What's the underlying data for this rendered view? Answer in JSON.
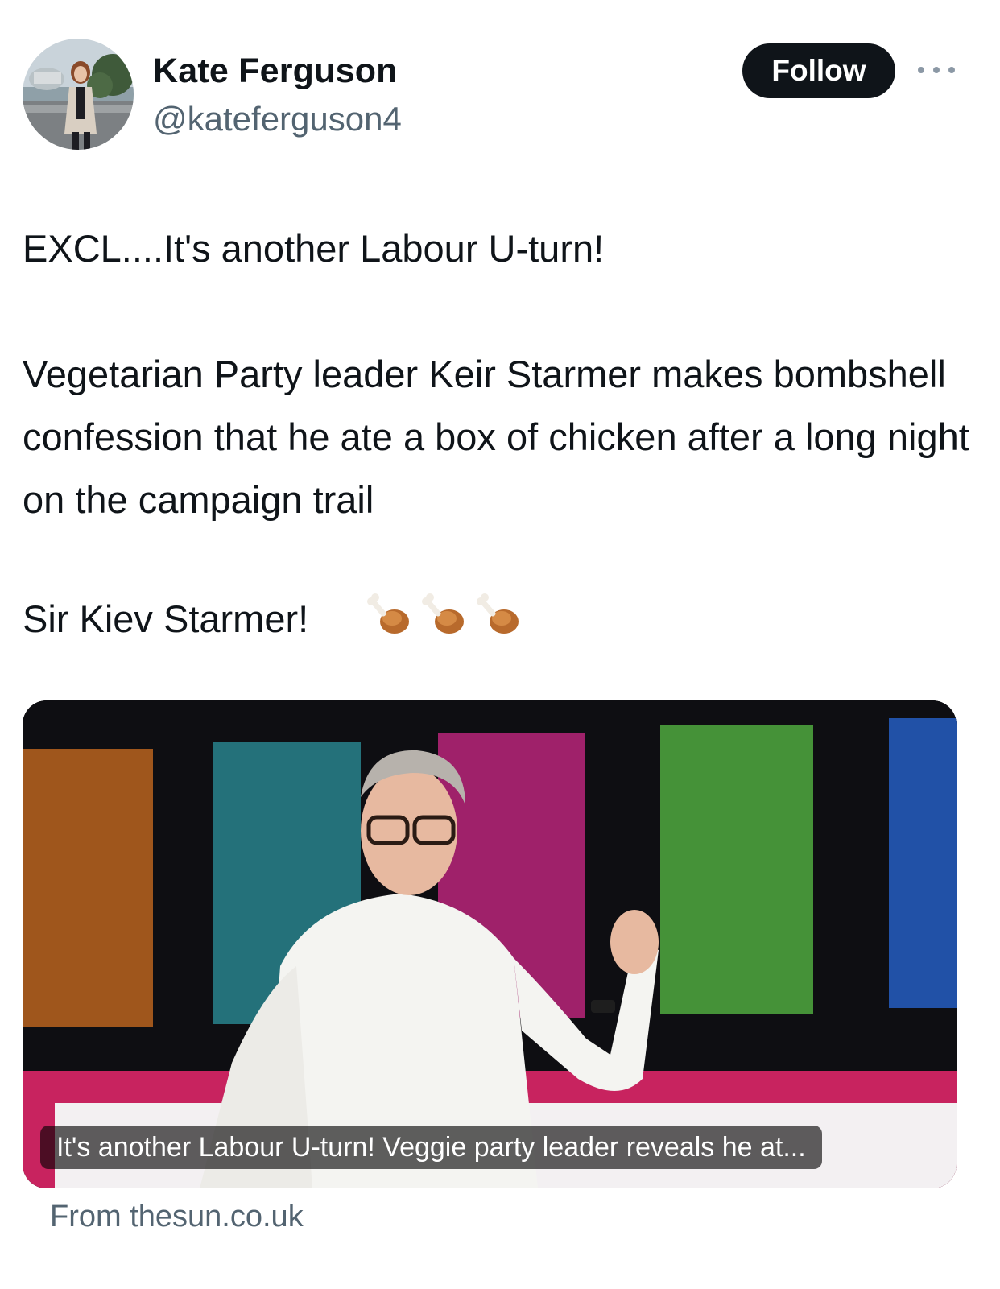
{
  "author": {
    "name": "Kate Ferguson",
    "handle": "@kateferguson4"
  },
  "follow_label": "Follow",
  "more_icon": "more-horizontal-icon",
  "tweet": {
    "body": "EXCL....It's another Labour U-turn!\n\nVegetarian Party leader Keir Starmer makes bombshell confession that he ate a box of chicken after a long night on the campaign trail",
    "closing": "Sir Kiev Starmer!",
    "emoji": [
      "poultry-leg-icon",
      "poultry-leg-icon",
      "poultry-leg-icon"
    ]
  },
  "link_card": {
    "caption": "It's another Labour U-turn! Veggie party leader reveals he at...",
    "source": "From thesun.co.uk"
  },
  "colors": {
    "follow_bg": "#0f1419",
    "secondary_text": "#536471"
  }
}
